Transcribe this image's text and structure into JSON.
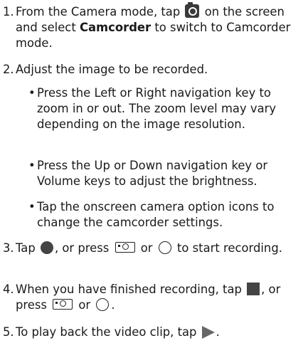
{
  "steps": {
    "s1": {
      "num": "1.",
      "pre": "From the Camera mode, tap",
      "post": "on the screen and select",
      "bold": "Camcorder",
      "end": "to switch to Camcorder mode.",
      "icon": "camera-icon"
    },
    "s2": {
      "num": "2.",
      "text": "Adjust the image to be recorded."
    },
    "s2_bullets": [
      "Press the Left or Right navigation key to zoom in or out. The zoom level may vary depending on the image resolution.",
      "Press the Up or Down navigation key or Volume keys to adjust the brightness.",
      "Tap the onscreen camera option icons to change the camcorder settings."
    ],
    "s3": {
      "num": "3.",
      "a": "Tap",
      "b": ", or press",
      "c": "or",
      "d": "to start recording.",
      "icons": [
        "record-dot-icon",
        "camera-key-icon",
        "circle-key-icon"
      ]
    },
    "s4": {
      "num": "4.",
      "a": "When you have finished recording, tap",
      "b": ", or press",
      "c": "or",
      "d": ".",
      "icons": [
        "stop-square-icon",
        "camera-key-icon",
        "circle-key-icon"
      ]
    },
    "s5": {
      "num": "5.",
      "a": "To play back the video clip, tap",
      "b": ".",
      "icon": "play-icon"
    }
  },
  "bullet_char": "•"
}
